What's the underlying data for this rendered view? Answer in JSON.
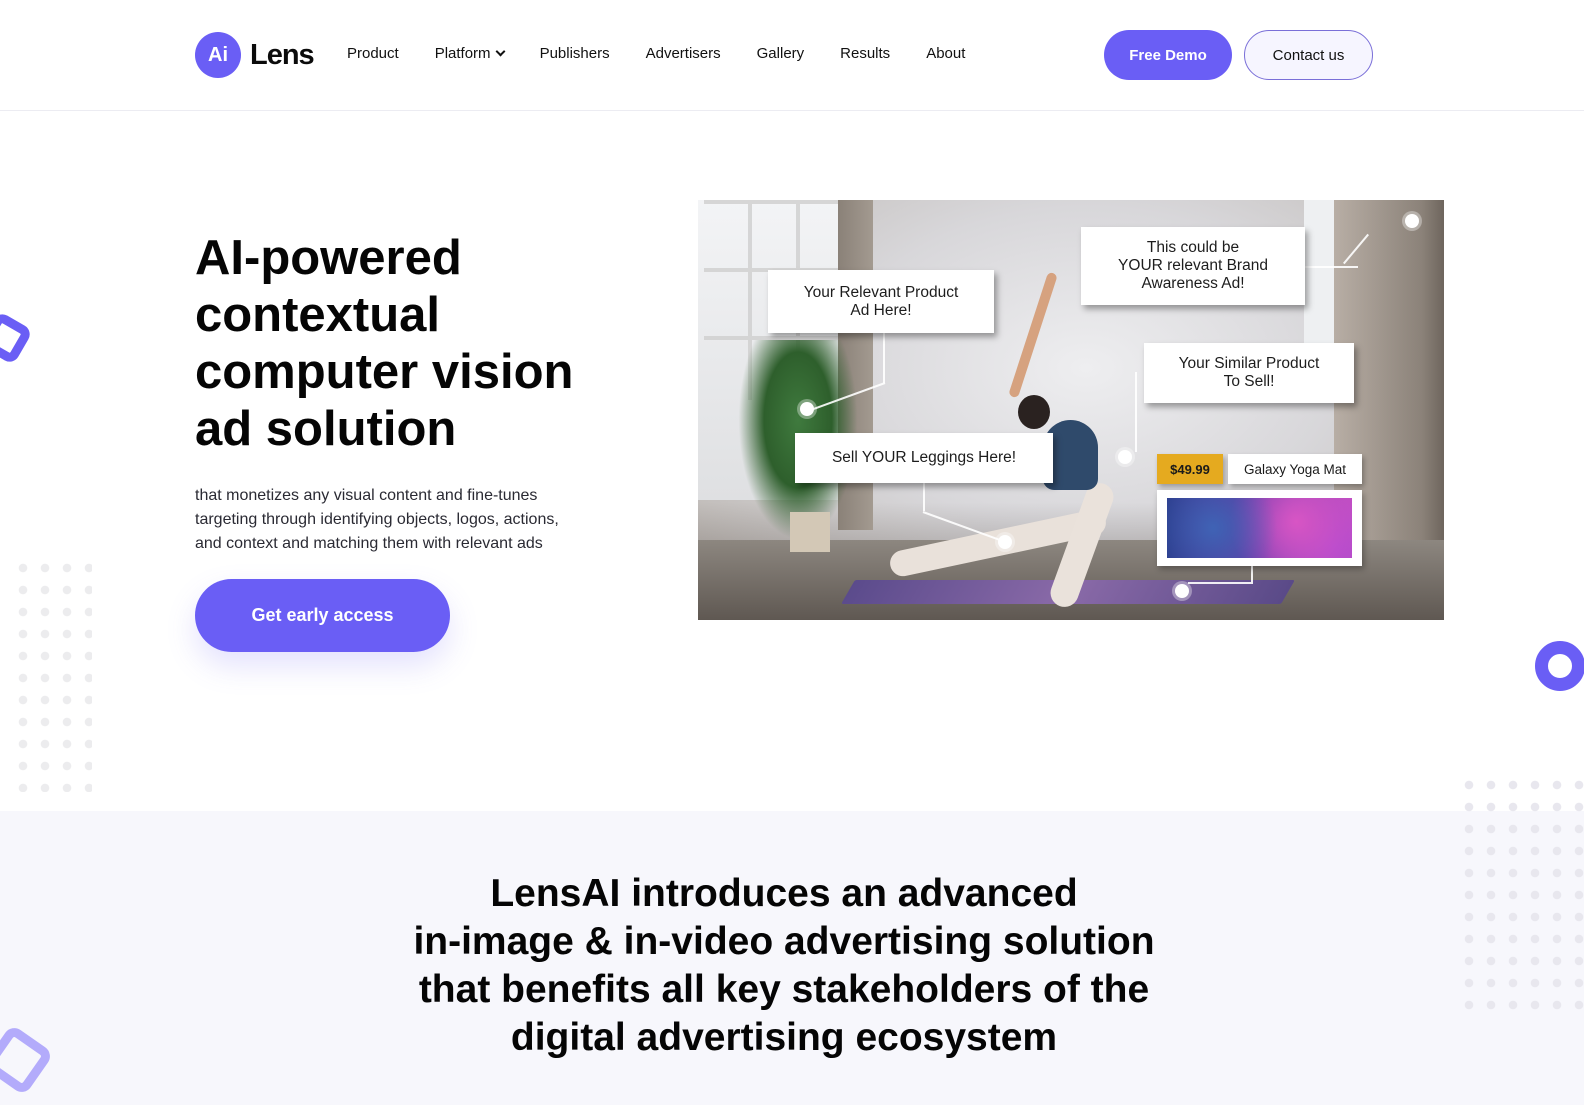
{
  "brand": {
    "badge": "Ai",
    "name": "Lens",
    "accent_color": "#6a5ef5"
  },
  "nav": {
    "items": [
      {
        "label": "Product"
      },
      {
        "label": "Platform",
        "has_dropdown": true,
        "icon": "chevron-down-icon"
      },
      {
        "label": "Publishers"
      },
      {
        "label": "Advertisers"
      },
      {
        "label": "Gallery"
      },
      {
        "label": "Results"
      },
      {
        "label": "About"
      }
    ],
    "free_demo_label": "Free Demo",
    "contact_label": "Contact us"
  },
  "hero": {
    "title_lines": [
      "AI-powered",
      "contextual",
      "computer vision",
      "ad solution"
    ],
    "subtitle_lines": [
      "that monetizes any visual content and fine-tunes",
      "targeting through identifying objects, logos, actions,",
      "and context and matching them with relevant ads"
    ],
    "cta_label": "Get early access",
    "image": {
      "ads": {
        "product_ad": [
          "Your Relevant Product",
          "Ad Here!"
        ],
        "brand_ad": [
          "This could be",
          "YOUR relevant Brand",
          "Awareness Ad!"
        ],
        "similar_product": [
          "Your Similar Product",
          "To Sell!"
        ],
        "leggings": [
          "Sell YOUR Leggings Here!"
        ]
      },
      "product_card": {
        "price": "$49.99",
        "name": "Galaxy Yoga Mat",
        "price_color": "#e5aa1f"
      }
    }
  },
  "section2": {
    "title_lines": [
      "LensAI introduces an advanced",
      "in-image & in-video advertising solution",
      "that benefits all key stakeholders of the",
      "digital advertising ecosystem"
    ]
  }
}
